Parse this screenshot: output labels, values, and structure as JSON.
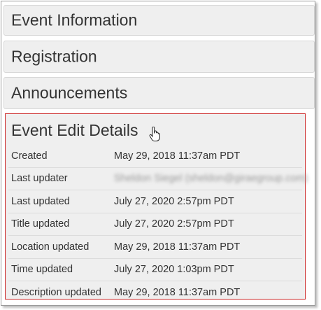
{
  "panels": [
    {
      "title": "Event Information"
    },
    {
      "title": "Registration"
    },
    {
      "title": "Announcements"
    }
  ],
  "details": {
    "title": "Event Edit Details",
    "rows": [
      {
        "label": "Created",
        "value": "May 29, 2018 11:37am PDT"
      },
      {
        "label": "Last updater",
        "value": "Sheldon Siegel (sheldon@giraegroup.com)"
      },
      {
        "label": "Last updated",
        "value": "July 27, 2020 2:57pm PDT"
      },
      {
        "label": "Title updated",
        "value": "July 27, 2020 2:57pm PDT"
      },
      {
        "label": "Location updated",
        "value": "May 29, 2018 11:37am PDT"
      },
      {
        "label": "Time updated",
        "value": "July 27, 2020 1:03pm PDT"
      },
      {
        "label": "Description updated",
        "value": "May 29, 2018 11:37am PDT"
      }
    ]
  },
  "colors": {
    "highlight_border": "#cc2a2a",
    "panel_bg": "#efefef"
  }
}
